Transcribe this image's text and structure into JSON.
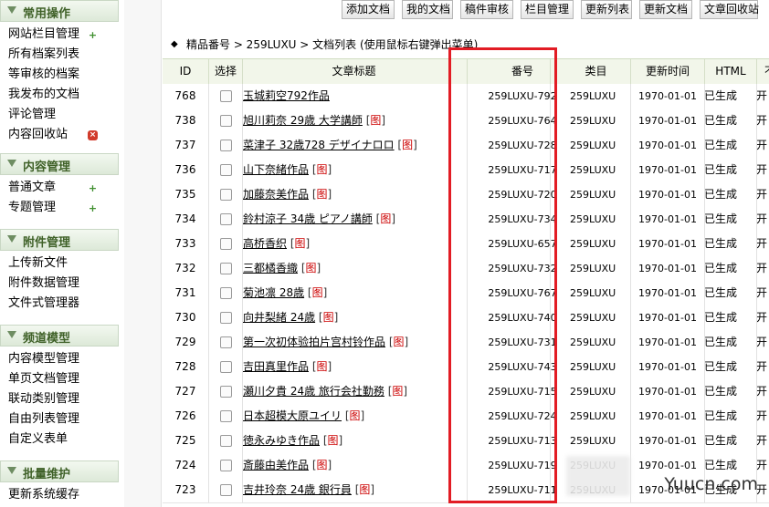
{
  "sidebar": {
    "sections": [
      {
        "title": "常用操作",
        "items": [
          {
            "label": "网站栏目管理",
            "icon": "add-icon"
          },
          {
            "label": "所有档案列表",
            "icon": ""
          },
          {
            "label": "等审核的档案",
            "icon": ""
          },
          {
            "label": "我发布的文档",
            "icon": ""
          },
          {
            "label": "评论管理",
            "icon": ""
          },
          {
            "label": "内容回收站",
            "icon": "recycle-icon"
          }
        ]
      },
      {
        "title": "内容管理",
        "items": [
          {
            "label": "普通文章",
            "icon": "add-icon"
          },
          {
            "label": "专题管理",
            "icon": "add-icon"
          }
        ]
      },
      {
        "title": "附件管理",
        "items": [
          {
            "label": "上传新文件",
            "icon": ""
          },
          {
            "label": "附件数据管理",
            "icon": ""
          },
          {
            "label": "文件式管理器",
            "icon": ""
          }
        ]
      },
      {
        "title": "频道模型",
        "items": [
          {
            "label": "内容模型管理",
            "icon": ""
          },
          {
            "label": "单页文档管理",
            "icon": ""
          },
          {
            "label": "联动类别管理",
            "icon": ""
          },
          {
            "label": "自由列表管理",
            "icon": ""
          },
          {
            "label": "自定义表单",
            "icon": ""
          }
        ]
      },
      {
        "title": "批量维护",
        "items": [
          {
            "label": "更新系统缓存",
            "icon": ""
          }
        ]
      }
    ]
  },
  "toolbar": {
    "buttons": [
      "添加文档",
      "我的文档",
      "稿件审核",
      "栏目管理",
      "更新列表",
      "更新文档",
      "文章回收站"
    ]
  },
  "breadcrumb": {
    "text": "精品番号 > 259LUXU > 文档列表  (使用鼠标右键弹出菜单)"
  },
  "table": {
    "headers": [
      "ID",
      "选择",
      "文章标题",
      "番号",
      "类目",
      "更新时间",
      "HTML",
      "不"
    ],
    "rows": [
      {
        "id": "768",
        "title": "玉城莉空792作品",
        "has_pic": false,
        "code": "259LUXU-792",
        "cat": "259LUXU",
        "time": "1970-01-01",
        "html": "已生成",
        "more": "开"
      },
      {
        "id": "738",
        "title": "旭川莉奈 29歳 大学講師",
        "has_pic": true,
        "code": "259LUXU-764",
        "cat": "259LUXU",
        "time": "1970-01-01",
        "html": "已生成",
        "more": "开"
      },
      {
        "id": "737",
        "title": "菜津子 32歳728 デザイナロロ",
        "has_pic": true,
        "code": "259LUXU-728",
        "cat": "259LUXU",
        "time": "1970-01-01",
        "html": "已生成",
        "more": "开"
      },
      {
        "id": "736",
        "title": "山下奈緒作品",
        "has_pic": true,
        "code": "259LUXU-717",
        "cat": "259LUXU",
        "time": "1970-01-01",
        "html": "已生成",
        "more": "开"
      },
      {
        "id": "735",
        "title": "加藤奈美作品",
        "has_pic": true,
        "code": "259LUXU-720",
        "cat": "259LUXU",
        "time": "1970-01-01",
        "html": "已生成",
        "more": "开"
      },
      {
        "id": "734",
        "title": "鈴村涼子 34歳 ピアノ講師",
        "has_pic": true,
        "code": "259LUXU-734",
        "cat": "259LUXU",
        "time": "1970-01-01",
        "html": "已生成",
        "more": "开"
      },
      {
        "id": "733",
        "title": "高桥香织",
        "has_pic": true,
        "code": "259LUXU-657",
        "cat": "259LUXU",
        "time": "1970-01-01",
        "html": "已生成",
        "more": "开"
      },
      {
        "id": "732",
        "title": "三都橘香織",
        "has_pic": true,
        "code": "259LUXU-732",
        "cat": "259LUXU",
        "time": "1970-01-01",
        "html": "已生成",
        "more": "开"
      },
      {
        "id": "731",
        "title": "菊池凛 28歳",
        "has_pic": true,
        "code": "259LUXU-767",
        "cat": "259LUXU",
        "time": "1970-01-01",
        "html": "已生成",
        "more": "开"
      },
      {
        "id": "730",
        "title": "向井梨緒 24歳",
        "has_pic": true,
        "code": "259LUXU-740",
        "cat": "259LUXU",
        "time": "1970-01-01",
        "html": "已生成",
        "more": "开"
      },
      {
        "id": "729",
        "title": "第一次初体验拍片宫村铃作品",
        "has_pic": true,
        "code": "259LUXU-731",
        "cat": "259LUXU",
        "time": "1970-01-01",
        "html": "已生成",
        "more": "开"
      },
      {
        "id": "728",
        "title": "吉田真里作品",
        "has_pic": true,
        "code": "259LUXU-743",
        "cat": "259LUXU",
        "time": "1970-01-01",
        "html": "已生成",
        "more": "开"
      },
      {
        "id": "727",
        "title": "瀬川夕貴 24歳 旅行会社勤務",
        "has_pic": true,
        "code": "259LUXU-715",
        "cat": "259LUXU",
        "time": "1970-01-01",
        "html": "已生成",
        "more": "开"
      },
      {
        "id": "726",
        "title": "日本超模大原ユイリ",
        "has_pic": true,
        "code": "259LUXU-724",
        "cat": "259LUXU",
        "time": "1970-01-01",
        "html": "已生成",
        "more": "开"
      },
      {
        "id": "725",
        "title": "徳永みゆき作品",
        "has_pic": true,
        "code": "259LUXU-713",
        "cat": "259LUXU",
        "time": "1970-01-01",
        "html": "已生成",
        "more": "开"
      },
      {
        "id": "724",
        "title": "斎藤由美作品",
        "has_pic": true,
        "code": "259LUXU-719",
        "cat": "259LUXU",
        "time": "1970-01-01",
        "html": "已生成",
        "more": "开"
      },
      {
        "id": "723",
        "title": "吉井玲奈 24歳 銀行員",
        "has_pic": true,
        "code": "259LUXU-711",
        "cat": "259LUXU",
        "time": "1970-01-01",
        "html": "已生成",
        "more": "开"
      }
    ],
    "pic_label": "图"
  },
  "watermark": "Yuucn.com",
  "colors": {
    "highlight": "#e21c24",
    "section_title": "#3f6128",
    "header_bg": "#f2f6ea"
  }
}
